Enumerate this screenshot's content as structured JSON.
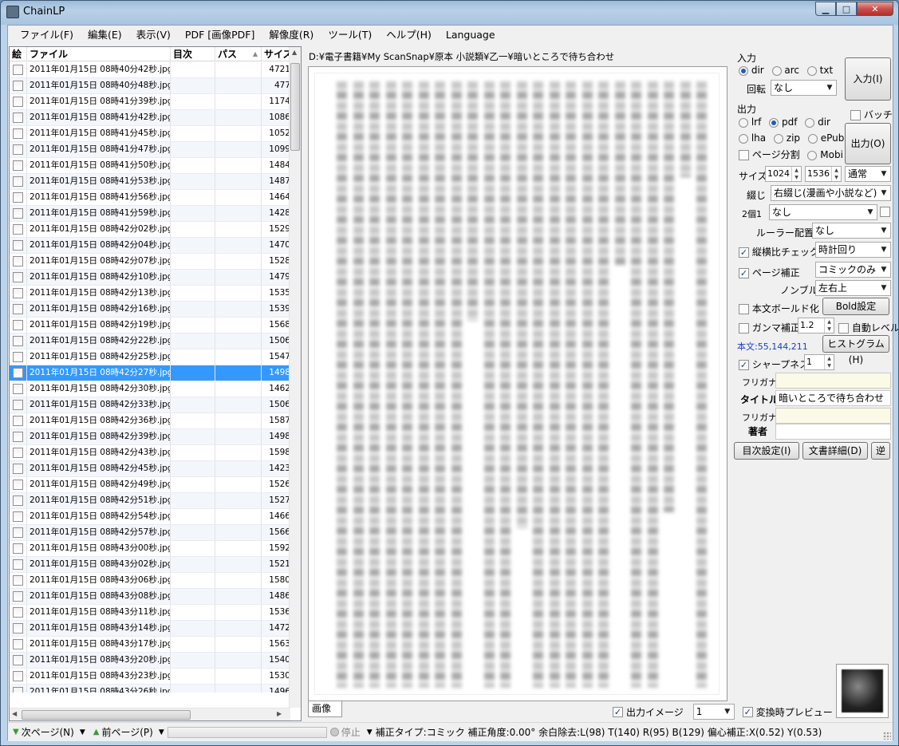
{
  "window": {
    "title": "ChainLP"
  },
  "menu": [
    "ファイル(F)",
    "編集(E)",
    "表示(V)",
    "PDF [画像PDF]",
    "解像度(R)",
    "ツール(T)",
    "ヘルプ(H)",
    "Language"
  ],
  "file_list": {
    "columns": {
      "pic": "絵",
      "file": "ファイル",
      "toc": "目次",
      "pass": "パス",
      "size": "サイズ"
    },
    "rows": [
      {
        "file": "2011年01月15日 08時40分42秒.jpg",
        "size": "4721"
      },
      {
        "file": "2011年01月15日 08時40分48秒.jpg",
        "size": "477"
      },
      {
        "file": "2011年01月15日 08時41分39秒.jpg",
        "size": "1174"
      },
      {
        "file": "2011年01月15日 08時41分42秒.jpg",
        "size": "1086"
      },
      {
        "file": "2011年01月15日 08時41分45秒.jpg",
        "size": "1052"
      },
      {
        "file": "2011年01月15日 08時41分47秒.jpg",
        "size": "1099"
      },
      {
        "file": "2011年01月15日 08時41分50秒.jpg",
        "size": "1484"
      },
      {
        "file": "2011年01月15日 08時41分53秒.jpg",
        "size": "1487"
      },
      {
        "file": "2011年01月15日 08時41分56秒.jpg",
        "size": "1464"
      },
      {
        "file": "2011年01月15日 08時41分59秒.jpg",
        "size": "1428"
      },
      {
        "file": "2011年01月15日 08時42分02秒.jpg",
        "size": "1529"
      },
      {
        "file": "2011年01月15日 08時42分04秒.jpg",
        "size": "1470"
      },
      {
        "file": "2011年01月15日 08時42分07秒.jpg",
        "size": "1528"
      },
      {
        "file": "2011年01月15日 08時42分10秒.jpg",
        "size": "1479"
      },
      {
        "file": "2011年01月15日 08時42分13秒.jpg",
        "size": "1535"
      },
      {
        "file": "2011年01月15日 08時42分16秒.jpg",
        "size": "1539"
      },
      {
        "file": "2011年01月15日 08時42分19秒.jpg",
        "size": "1568"
      },
      {
        "file": "2011年01月15日 08時42分22秒.jpg",
        "size": "1506"
      },
      {
        "file": "2011年01月15日 08時42分25秒.jpg",
        "size": "1547"
      },
      {
        "file": "2011年01月15日 08時42分27秒.jpg",
        "size": "1498",
        "selected": true
      },
      {
        "file": "2011年01月15日 08時42分30秒.jpg",
        "size": "1462"
      },
      {
        "file": "2011年01月15日 08時42分33秒.jpg",
        "size": "1506"
      },
      {
        "file": "2011年01月15日 08時42分36秒.jpg",
        "size": "1587"
      },
      {
        "file": "2011年01月15日 08時42分39秒.jpg",
        "size": "1498"
      },
      {
        "file": "2011年01月15日 08時42分43秒.jpg",
        "size": "1598"
      },
      {
        "file": "2011年01月15日 08時42分45秒.jpg",
        "size": "1423"
      },
      {
        "file": "2011年01月15日 08時42分49秒.jpg",
        "size": "1526"
      },
      {
        "file": "2011年01月15日 08時42分51秒.jpg",
        "size": "1527"
      },
      {
        "file": "2011年01月15日 08時42分54秒.jpg",
        "size": "1466"
      },
      {
        "file": "2011年01月15日 08時42分57秒.jpg",
        "size": "1566"
      },
      {
        "file": "2011年01月15日 08時43分00秒.jpg",
        "size": "1592"
      },
      {
        "file": "2011年01月15日 08時43分02秒.jpg",
        "size": "1521"
      },
      {
        "file": "2011年01月15日 08時43分06秒.jpg",
        "size": "1580"
      },
      {
        "file": "2011年01月15日 08時43分08秒.jpg",
        "size": "1486"
      },
      {
        "file": "2011年01月15日 08時43分11秒.jpg",
        "size": "1536"
      },
      {
        "file": "2011年01月15日 08時43分14秒.jpg",
        "size": "1472"
      },
      {
        "file": "2011年01月15日 08時43分17秒.jpg",
        "size": "1563"
      },
      {
        "file": "2011年01月15日 08時43分20秒.jpg",
        "size": "1540"
      },
      {
        "file": "2011年01月15日 08時43分23秒.jpg",
        "size": "1530"
      },
      {
        "file": "2011年01月15日 08時43分26秒.jpg",
        "size": "1496"
      }
    ]
  },
  "preview": {
    "path": "D:¥電子書籍¥My ScanSnap¥原本 小説類¥乙一¥暗いところで待ち合わせ",
    "tab": "画像",
    "output_image_label": "出力イメージ",
    "output_image_value": "1",
    "convert_preview_label": "変換時プレビュー"
  },
  "settings": {
    "input_label": "入力",
    "input_types": [
      "dir",
      "arc",
      "txt"
    ],
    "rotate_label": "回転",
    "rotate_value": "なし",
    "input_button": "入力(I)",
    "output_label": "出力",
    "batch_label": "バッチ",
    "output_types_row1": [
      "lrf",
      "pdf",
      "dir"
    ],
    "output_types_row2": [
      "lha",
      "zip",
      "ePub"
    ],
    "page_split_label": "ページ分割",
    "mobi_label": "Mobi",
    "output_button": "出力(O)",
    "size_label": "サイズ",
    "size_w": "1024",
    "size_h": "1536",
    "size_mode": "通常",
    "binding_label": "綴じ",
    "binding_value": "右綴じ(漫画や小説など)",
    "two_in_one_label": "2個1",
    "two_in_one_value": "なし",
    "ruler_label": "ルーラー配置",
    "ruler_value": "なし",
    "aspect_check_label": "縦横比チェック",
    "aspect_value": "時計回り",
    "page_correct_label": "ページ補正",
    "page_correct_value": "コミックのみ",
    "nombre_label": "ノンブル",
    "nombre_value": "左右上",
    "bold_text_label": "本文ボールド化",
    "bold_button": "Bold設定",
    "gamma_label": "ガンマ補正",
    "gamma_value": "1.2",
    "auto_level_label": "自動レベル",
    "body_level": "本文:55,144,211",
    "histogram_button": "ヒストグラム(H)",
    "sharpness_label": "シャープネス",
    "sharpness_value": "1",
    "furigana_label": "フリガナ",
    "title_label": "タイトル",
    "title_value": "暗いところで待ち合わせ",
    "furigana2_label": "フリガナ",
    "author_label": "著者",
    "toc_button": "目次設定(I)",
    "doc_detail_button": "文書詳細(D)",
    "reverse_button": "逆"
  },
  "status": {
    "next_page": "次ページ(N)",
    "prev_page": "前ページ(P)",
    "stop": "停止",
    "info": "補正タイプ:コミック 補正角度:0.00° 余白除去:L(98) T(140) R(95) B(129) 偏心補正:X(0.52) Y(0.53)"
  }
}
